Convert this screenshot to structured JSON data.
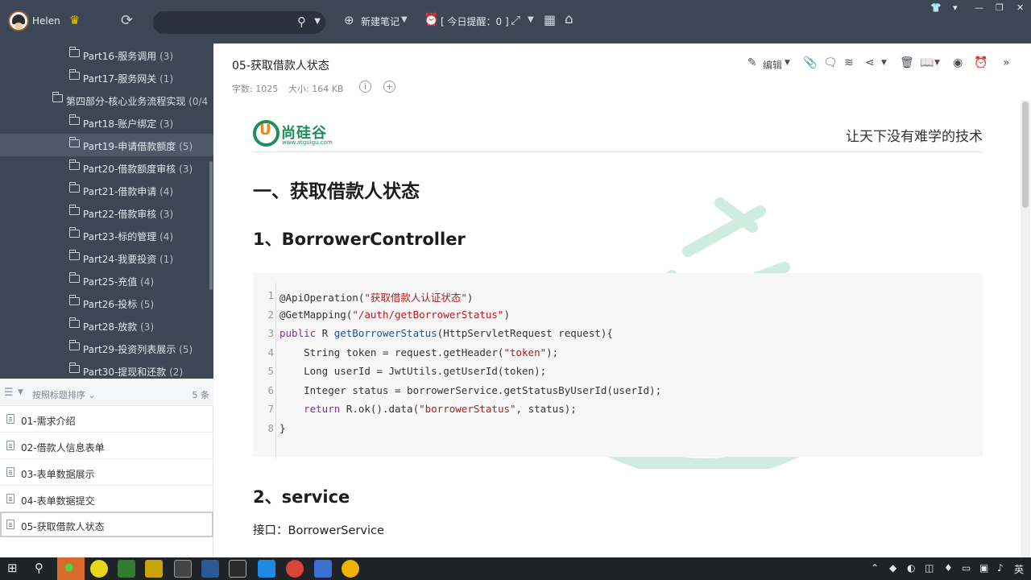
{
  "topbar": {
    "username": "Helen",
    "new_note_label": "新建笔记",
    "reminder_label": "[ 今日提醒：0 ]"
  },
  "tree": {
    "items": [
      {
        "label": "Part16-服务调用",
        "count": "(3)"
      },
      {
        "label": "Part17-服务网关",
        "count": "(1)"
      },
      {
        "label": "第四部分-核心业务流程实现",
        "count": "(0/4"
      },
      {
        "label": "Part18-账户绑定",
        "count": "(3)"
      },
      {
        "label": "Part19-申请借款额度",
        "count": "(5)"
      },
      {
        "label": "Part20-借款额度审核",
        "count": "(3)"
      },
      {
        "label": "Part21-借款申请",
        "count": "(4)"
      },
      {
        "label": "Part22-借款审核",
        "count": "(3)"
      },
      {
        "label": "Part23-标的管理",
        "count": "(4)"
      },
      {
        "label": "Part24-我要投资",
        "count": "(1)"
      },
      {
        "label": "Part25-充值",
        "count": "(4)"
      },
      {
        "label": "Part26-投标",
        "count": "(5)"
      },
      {
        "label": "Part28-放款",
        "count": "(3)"
      },
      {
        "label": "Part29-投资列表展示",
        "count": "(5)"
      },
      {
        "label": "Part30-提现和还款",
        "count": "(2)"
      }
    ]
  },
  "notelist": {
    "sort_label": "按照标题排序",
    "count_label": "5 条",
    "notes": [
      {
        "title": "01-需求介绍"
      },
      {
        "title": "02-借款人信息表单"
      },
      {
        "title": "03-表单数据展示"
      },
      {
        "title": "04-表单数据提交"
      },
      {
        "title": "05-获取借款人状态"
      }
    ]
  },
  "editor": {
    "note_title": "05-获取借款人状态",
    "word_count": "字数: 1025",
    "size": "大小: 164 KB",
    "edit_label": "编辑"
  },
  "document": {
    "logo_text": "尚硅谷",
    "logo_url": "www.atguigu.com",
    "slogan": "让天下没有难学的技术",
    "heading1": "一、获取借款人状态",
    "heading2_1": "1、BorrowerController",
    "code_lines": [
      {
        "n": "1",
        "text": "@ApiOperation(\"获取借款人认证状态\")"
      },
      {
        "n": "2",
        "text": "@GetMapping(\"/auth/getBorrowerStatus\")"
      },
      {
        "n": "3",
        "text": "public R getBorrowerStatus(HttpServletRequest request){"
      },
      {
        "n": "4",
        "text": "    String token = request.getHeader(\"token\");"
      },
      {
        "n": "5",
        "text": "    Long userId = JwtUtils.getUserId(token);"
      },
      {
        "n": "6",
        "text": "    Integer status = borrowerService.getStatusByUserId(userId);"
      },
      {
        "n": "7",
        "text": "    return R.ok().data(\"borrowerStatus\", status);"
      },
      {
        "n": "8",
        "text": "}"
      }
    ],
    "heading2_2": "2、service",
    "interface_line": "接口：BorrowerService"
  },
  "taskbar": {
    "ime": "英"
  },
  "colors": {
    "sidebar_bg": "#3c4654",
    "accent_green": "#1e8d5b",
    "accent_orange": "#e68a1e"
  }
}
